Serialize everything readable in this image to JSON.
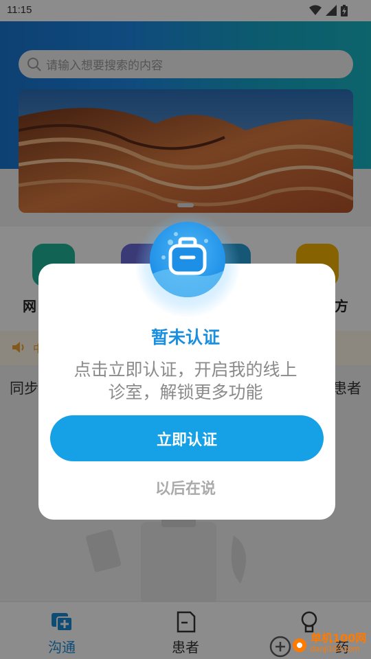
{
  "status_bar": {
    "time": "11:15"
  },
  "search": {
    "placeholder": "请输入想要搜索的内容"
  },
  "functions": {
    "left_label": "网",
    "right_label": "方"
  },
  "notice": {
    "text": "中"
  },
  "background_text": {
    "left": "同步",
    "right": "患者"
  },
  "dialog": {
    "title": "暂未认证",
    "description": "点击立即认证，开启我的线上诊室，解锁更多功能",
    "confirm_label": "立即认证",
    "later_label": "以后在说"
  },
  "tabs": [
    {
      "label": "沟通",
      "active": true
    },
    {
      "label": "患者",
      "active": false
    },
    {
      "label": "药",
      "active": false
    }
  ],
  "watermark": {
    "name": "单机100网",
    "url": "danji100.com"
  },
  "colors": {
    "accent": "#16a0e6",
    "title": "#1a8fe0",
    "header": "#1e88e5"
  }
}
